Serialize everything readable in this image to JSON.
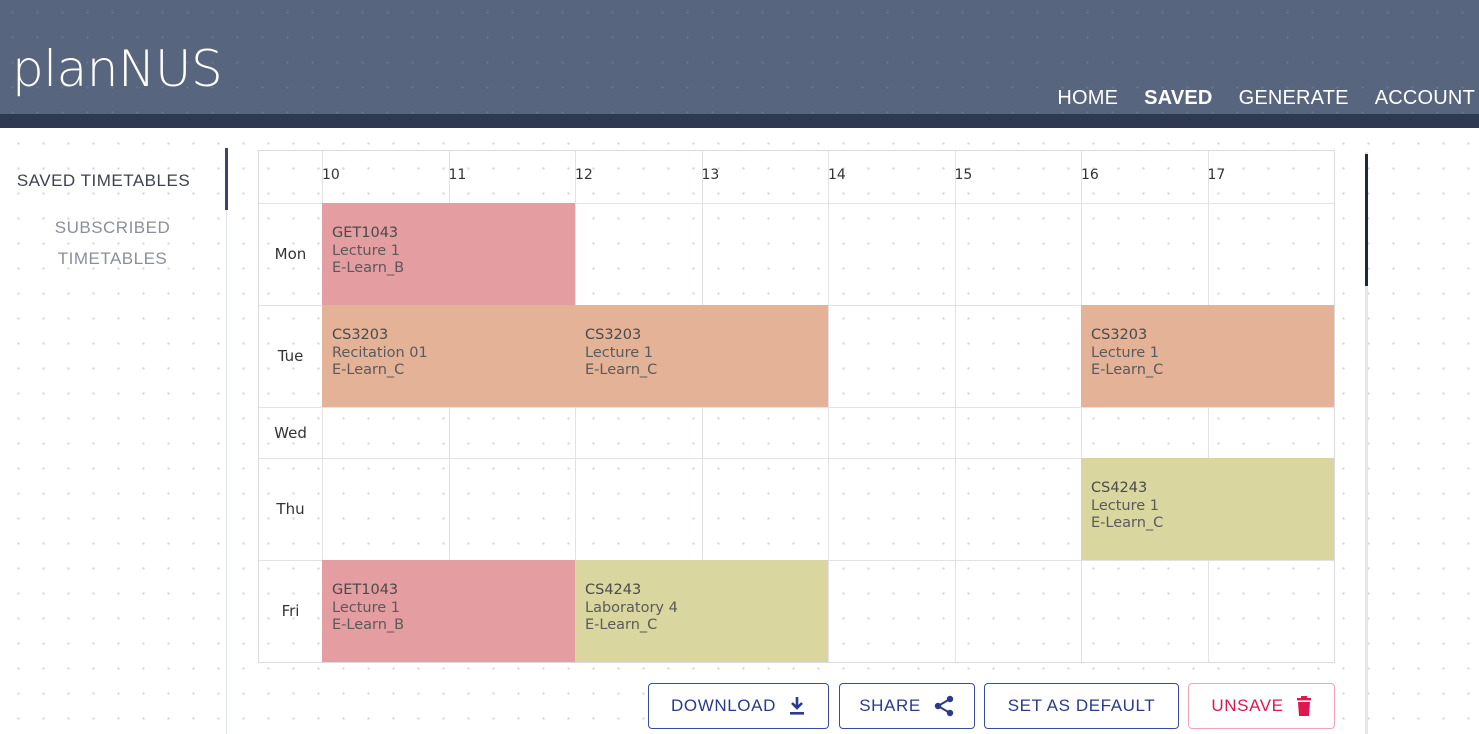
{
  "app": {
    "logo": "planNUS"
  },
  "nav": {
    "home": "HOME",
    "saved": "SAVED",
    "generate": "GENERATE",
    "account": "ACCOUNT"
  },
  "sidebar": {
    "saved_timetables": "SAVED TIMETABLES",
    "subscribed_line1": "SUBSCRIBED",
    "subscribed_line2": "TIMETABLES"
  },
  "timetable": {
    "hours": [
      "10",
      "11",
      "12",
      "13",
      "14",
      "15",
      "16",
      "17"
    ],
    "days": [
      "Mon",
      "Tue",
      "Wed",
      "Thu",
      "Fri"
    ],
    "slots": [
      {
        "code": "GET1043",
        "lesson": "Lecture 1",
        "venue": "E-Learn_B",
        "day": "Mon",
        "start": 10,
        "end": 12,
        "color": "#e49da0"
      },
      {
        "code": "CS3203",
        "lesson": "Recitation 01",
        "venue": "E-Learn_C",
        "day": "Tue",
        "start": 10,
        "end": 12,
        "color": "#e3b297"
      },
      {
        "code": "CS3203",
        "lesson": "Lecture 1",
        "venue": "E-Learn_C",
        "day": "Tue",
        "start": 12,
        "end": 14,
        "color": "#e3b297"
      },
      {
        "code": "CS3203",
        "lesson": "Lecture 1",
        "venue": "E-Learn_C",
        "day": "Tue",
        "start": 16,
        "end": 18,
        "color": "#e3b297"
      },
      {
        "code": "CS4243",
        "lesson": "Lecture 1",
        "venue": "E-Learn_C",
        "day": "Thu",
        "start": 16,
        "end": 18,
        "color": "#d9d69f"
      },
      {
        "code": "GET1043",
        "lesson": "Lecture 1",
        "venue": "E-Learn_B",
        "day": "Fri",
        "start": 10,
        "end": 12,
        "color": "#e49da0"
      },
      {
        "code": "CS4243",
        "lesson": "Laboratory 4",
        "venue": "E-Learn_C",
        "day": "Fri",
        "start": 12,
        "end": 14,
        "color": "#d9d69f"
      }
    ]
  },
  "actions": {
    "download": "DOWNLOAD",
    "share": "SHARE",
    "set_default": "SET AS DEFAULT",
    "unsave": "UNSAVE"
  },
  "colors": {
    "header": "#58657f",
    "accent": "#2a3a8c",
    "danger": "#e0174f"
  }
}
